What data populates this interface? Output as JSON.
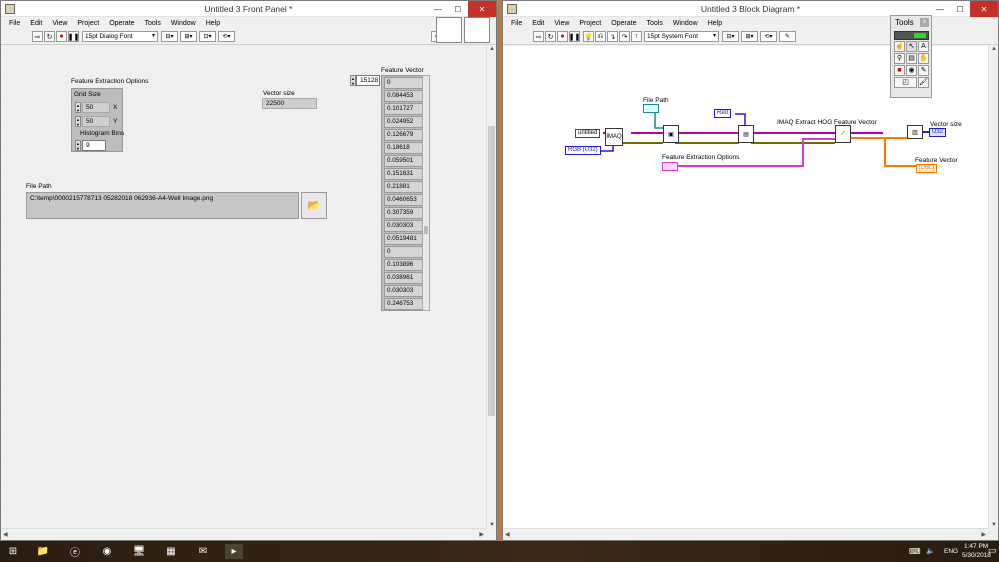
{
  "front_panel": {
    "title": "Untitled 3 Front Panel *",
    "menu": [
      "File",
      "Edit",
      "View",
      "Project",
      "Operate",
      "Tools",
      "Window",
      "Help"
    ],
    "font": "15pt Dialog Font",
    "feature_extraction_label": "Feature Extraction Options",
    "grid_size_label": "Grid Size",
    "grid_x": "50",
    "grid_x_label": "X",
    "grid_y": "50",
    "grid_y_label": "Y",
    "histogram_bins_label": "Histogram Bins",
    "histogram_bins": "9",
    "vector_size_label": "Vector size",
    "vector_size": "22500",
    "file_path_label": "File Path",
    "file_path": "C:\\temp\\0000215778713 05282018 062936-A4-Well Image.png",
    "feature_vector_label": "Feature Vector",
    "array_index": "15128",
    "feature_vector": [
      "0",
      "0.084453",
      "0.101727",
      "0.024952",
      "0.126679",
      "0.18618",
      "0.059501",
      "0.151631",
      "0.21881",
      "0.0460653",
      "0.307359",
      "0.030303",
      "0.0519481",
      "0",
      "0.103896",
      "0.038961",
      "0.030303",
      "0.246753"
    ]
  },
  "block_diagram": {
    "title": "Untitled 3 Block Diagram *",
    "menu": [
      "File",
      "Edit",
      "View",
      "Project",
      "Operate",
      "Tools",
      "Window",
      "Help"
    ],
    "font": "15pt System Font",
    "file_path_label": "File Path",
    "untitled_const": "untitled",
    "imaq_label": "IMAQ",
    "rgb_const": "RGB (U32)",
    "red_const": "Red",
    "feature_extraction_label": "Feature Extraction Options",
    "hog_label": "IMAQ Extract HOG Feature Vector",
    "vector_size_label": "Vector size",
    "vector_size_term": "U32",
    "feature_vector_label": "Feature Vector",
    "feature_vector_term": "[DBL]"
  },
  "tools_palette": {
    "title": "Tools",
    "close": "x"
  },
  "taskbar": {
    "lang": "ENG",
    "time": "1:47 PM",
    "date": "5/30/2018"
  }
}
